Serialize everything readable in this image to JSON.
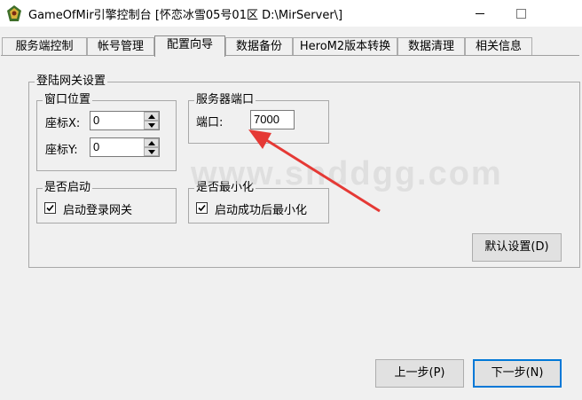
{
  "window": {
    "title": "GameOfMir引擎控制台 [怀恋冰雪05号01区 D:\\MirServer\\]",
    "minimize_icon": "minimize-icon",
    "maximize_icon": "maximize-icon"
  },
  "tabs": [
    {
      "label": "服务端控制"
    },
    {
      "label": "帐号管理"
    },
    {
      "label": "配置向导"
    },
    {
      "label": "数据备份"
    },
    {
      "label": "HeroM2版本转换"
    },
    {
      "label": "数据清理"
    },
    {
      "label": "相关信息"
    }
  ],
  "active_tab": "配置向导",
  "login_gateway": {
    "title": "登陆网关设置",
    "window_position": {
      "title": "窗口位置",
      "x_label": "座标X:",
      "x_value": "0",
      "y_label": "座标Y:",
      "y_value": "0"
    },
    "server_port": {
      "title": "服务器端口",
      "port_label": "端口:",
      "port_value": "7000"
    },
    "auto_start": {
      "title": "是否启动",
      "checkbox_label": "启动登录网关",
      "checked": true
    },
    "minimize": {
      "title": "是否最小化",
      "checkbox_label": "启动成功后最小化",
      "checked": true
    },
    "default_button": "默认设置(D)"
  },
  "nav": {
    "prev_button": "上一步(P)",
    "next_button": "下一步(N)"
  },
  "watermark": "www.snddgg.com",
  "colors": {
    "arrow": "#e53935",
    "focus": "#0078d7",
    "background": "#f0f0f0"
  }
}
